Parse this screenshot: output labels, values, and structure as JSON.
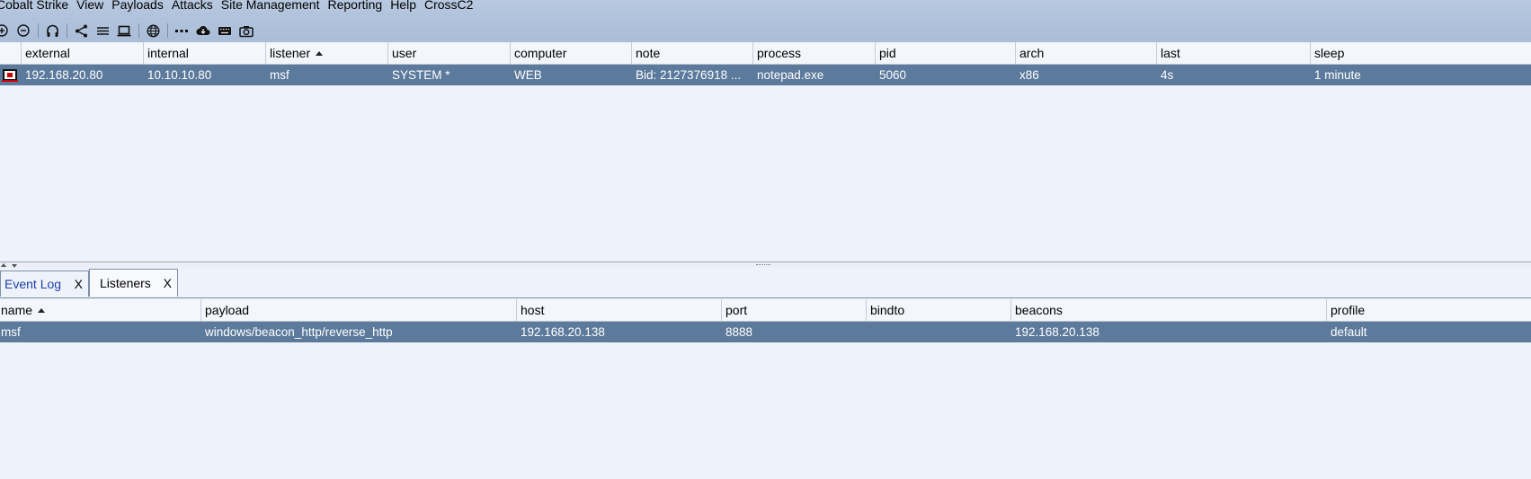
{
  "menubar": {
    "items": [
      "Cobalt Strike",
      "View",
      "Payloads",
      "Attacks",
      "Site Management",
      "Reporting",
      "Help",
      "CrossC2"
    ]
  },
  "toolbar": {
    "icons": [
      "plus-circle-icon",
      "minus-circle-icon",
      "headphones-icon",
      "share-icon",
      "list-icon",
      "laptop-icon",
      "globe-icon",
      "dots-icon",
      "cloud-download-icon",
      "keyboard-icon",
      "camera-icon"
    ]
  },
  "beacons": {
    "columns": [
      "external",
      "internal",
      "listener",
      "user",
      "computer",
      "note",
      "process",
      "pid",
      "arch",
      "last",
      "sleep"
    ],
    "sorted_column": "listener",
    "rows": [
      {
        "external": "192.168.20.80",
        "internal": "10.10.10.80",
        "listener": "msf",
        "user": "SYSTEM *",
        "computer": "WEB",
        "note": "Bid: 2127376918  ...",
        "process": "notepad.exe",
        "pid": "5060",
        "arch": "x86",
        "last": "4s",
        "sleep": "1 minute"
      }
    ]
  },
  "tabs": [
    {
      "label": "Event Log",
      "close": "X",
      "active": false
    },
    {
      "label": "Listeners",
      "close": "X",
      "active": true
    }
  ],
  "listeners": {
    "columns": [
      "name",
      "payload",
      "host",
      "port",
      "bindto",
      "beacons",
      "profile"
    ],
    "sorted_column": "name",
    "rows": [
      {
        "name": "msf",
        "payload": "windows/beacon_http/reverse_http",
        "host": "192.168.20.138",
        "port": "8888",
        "bindto": "",
        "beacons": "192.168.20.138",
        "profile": "default"
      }
    ]
  },
  "colors": {
    "selected_row": "#5c7a9c",
    "menubar": "#b0c3dc",
    "background": "#eef2fb"
  }
}
